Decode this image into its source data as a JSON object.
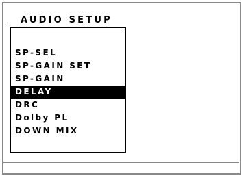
{
  "menu": {
    "title": "AUDIO SETUP",
    "selected_index": 3,
    "items": [
      {
        "label": "SP-SEL"
      },
      {
        "label": "SP-GAIN SET"
      },
      {
        "label": "SP-GAIN"
      },
      {
        "label": "DELAY"
      },
      {
        "label": "DRC"
      },
      {
        "label": "Dolby PL"
      },
      {
        "label": "DOWN MIX"
      }
    ]
  },
  "colors": {
    "highlight_background": "#000000",
    "highlight_text": "#ffffff",
    "text": "#000000",
    "frame": "#888888",
    "background": "#ffffff"
  }
}
